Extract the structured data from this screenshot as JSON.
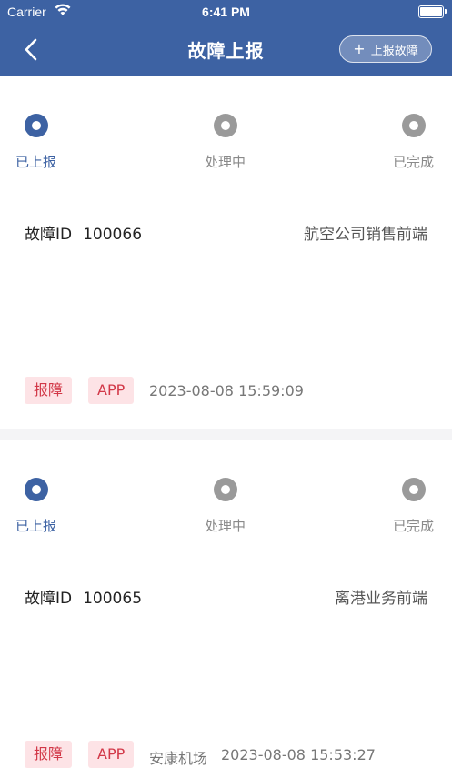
{
  "status_bar": {
    "carrier": "Carrier",
    "time": "6:41 PM"
  },
  "header": {
    "title": "故障上报",
    "report_button": "上报故障",
    "report_icon": "+"
  },
  "steps": [
    "已上报",
    "处理中",
    "已完成"
  ],
  "colors": {
    "primary": "#3d62a3",
    "tag_bg": "#fde3e6",
    "tag_text": "#d23848"
  },
  "records": [
    {
      "id_label": "故障ID",
      "id": "100066",
      "department": "航空公司销售前端",
      "tags": [
        "报障",
        "APP"
      ],
      "location": "",
      "datetime": "2023-08-08 15:59:09",
      "current_step": 0
    },
    {
      "id_label": "故障ID",
      "id": "100065",
      "department": "离港业务前端",
      "tags": [
        "报障",
        "APP"
      ],
      "location": "安康机场",
      "datetime": "2023-08-08 15:53:27",
      "current_step": 0
    }
  ]
}
